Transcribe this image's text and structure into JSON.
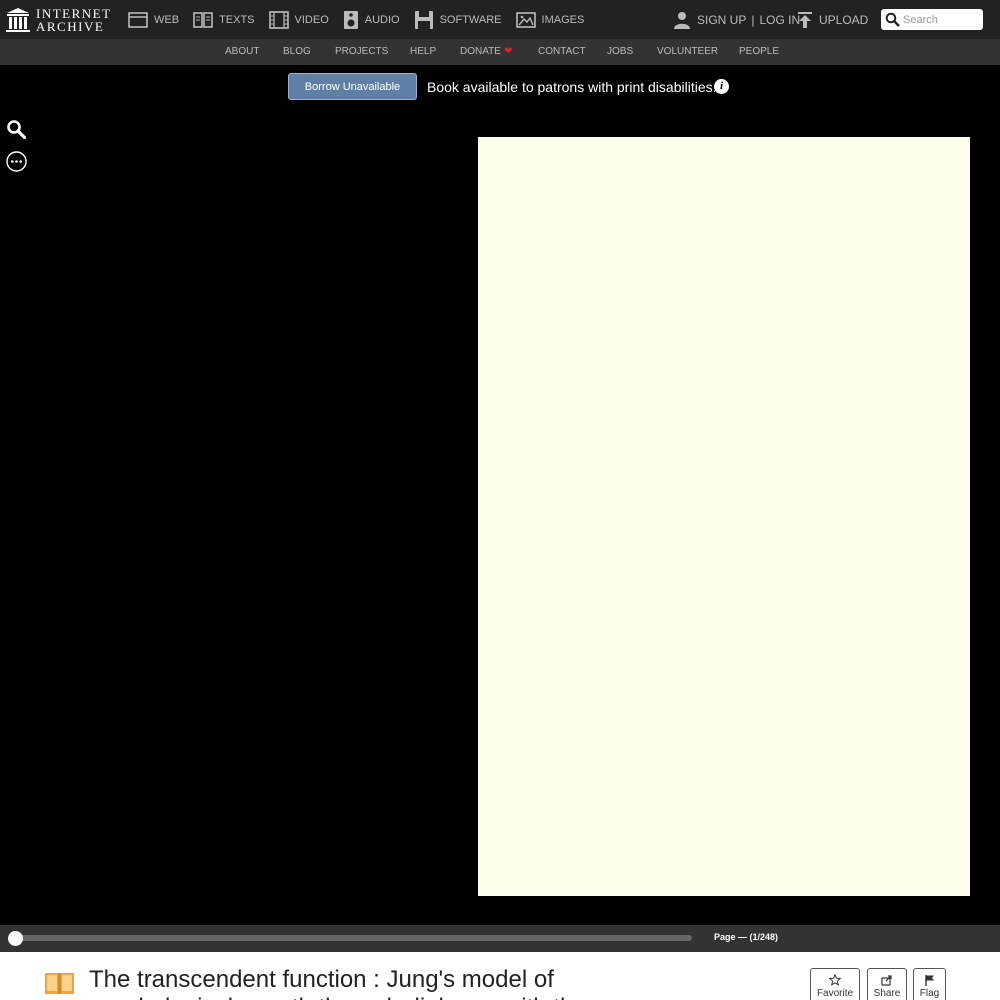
{
  "brand": {
    "line1": "INTERNET",
    "line2": "ARCHIVE"
  },
  "mediatypes": [
    {
      "label": "WEB",
      "icon": "web-icon"
    },
    {
      "label": "TEXTS",
      "icon": "texts-icon"
    },
    {
      "label": "VIDEO",
      "icon": "video-icon"
    },
    {
      "label": "AUDIO",
      "icon": "audio-icon"
    },
    {
      "label": "SOFTWARE",
      "icon": "software-icon"
    },
    {
      "label": "IMAGES",
      "icon": "images-icon"
    }
  ],
  "user": {
    "sign_up": "SIGN UP",
    "separator": "|",
    "log_in": "LOG IN",
    "icon": "user-icon"
  },
  "upload": {
    "label": "UPLOAD",
    "icon": "upload-icon"
  },
  "search": {
    "placeholder": "Search",
    "icon": "search-icon"
  },
  "subnav": [
    "ABOUT",
    "BLOG",
    "PROJECTS",
    "HELP",
    "DONATE",
    "CONTACT",
    "JOBS",
    "VOLUNTEER",
    "PEOPLE"
  ],
  "donate_heart": "❤",
  "borrow": {
    "button_label": "Borrow Unavailable",
    "message": "Book available to patrons with print disabilities.",
    "info": "i"
  },
  "reader": {
    "page_label": "Page — (1/248)",
    "page_progress": 0.0
  },
  "book": {
    "title": "The transcendent function : Jung's model of psychological growth through dialogue with the unconscious"
  },
  "actions": [
    {
      "label": "Favorite",
      "icon": "star-icon"
    },
    {
      "label": "Share",
      "icon": "share-icon"
    },
    {
      "label": "Flag",
      "icon": "flag-icon"
    }
  ],
  "colors": {
    "topnav": "#222222",
    "subnav": "#333333",
    "borrow_button": "#5f7fa6",
    "page": "#fffdeb",
    "book_icon": "#f3a338",
    "donate_heart": "#dd2222"
  }
}
